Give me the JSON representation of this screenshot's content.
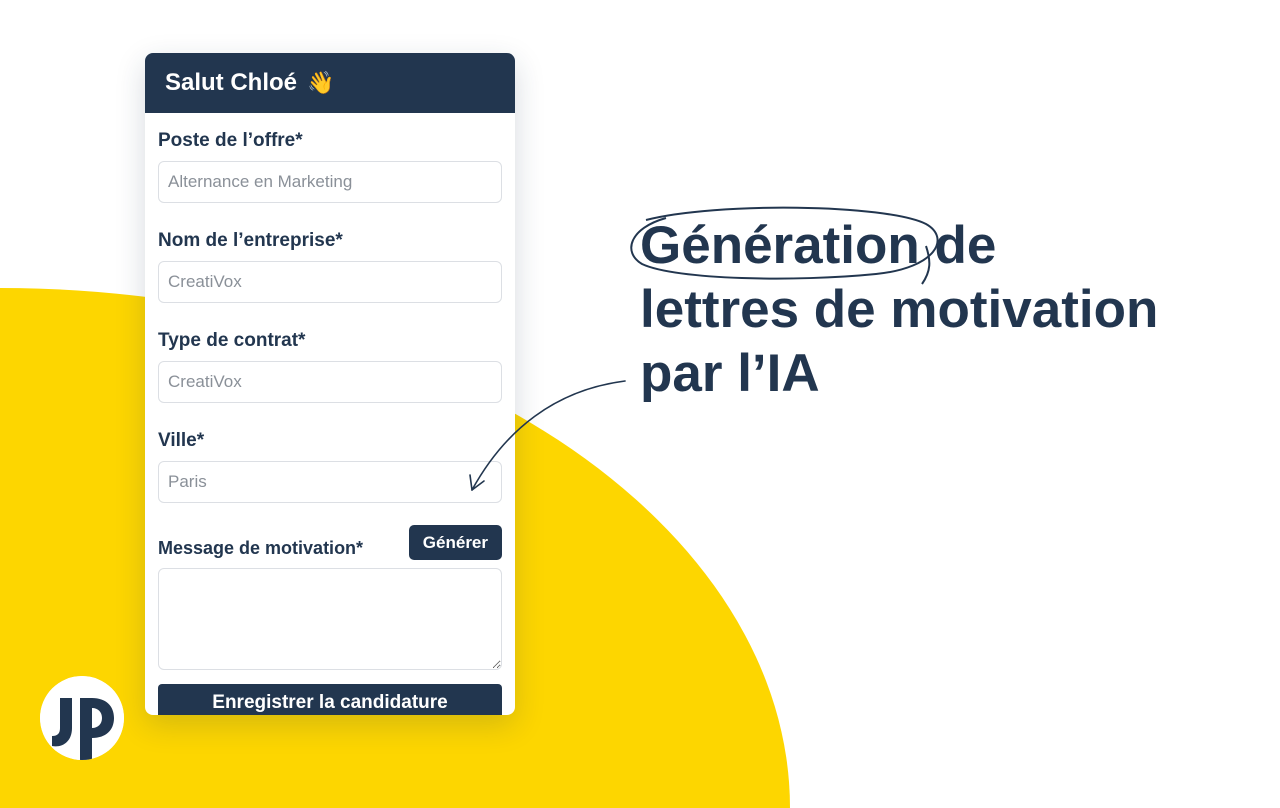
{
  "card": {
    "greeting": "Salut Chloé",
    "wave_emoji": "👋",
    "fields": [
      {
        "label": "Poste de l’offre*",
        "placeholder": "Alternance en Marketing"
      },
      {
        "label": "Nom de l’entreprise*",
        "placeholder": "CreatiVox"
      },
      {
        "label": "Type de contrat*",
        "placeholder": "CreatiVox"
      },
      {
        "label": "Ville*",
        "placeholder": "Paris"
      }
    ],
    "message_label": "Message de motivation*",
    "generate_label": "Générer",
    "save_label": "Enregistrer la candidature"
  },
  "headline": {
    "highlight": "Génération",
    "line1_rest": "de",
    "line2": "lettres de motivation",
    "line3": "par l’IA"
  },
  "colors": {
    "navy": "#22364f",
    "yellow": "#fdd600",
    "white": "#ffffff"
  },
  "icons": {
    "logo": "jp-logo",
    "arrow": "curved-arrow-icon",
    "wave": "waving-hand-icon"
  }
}
